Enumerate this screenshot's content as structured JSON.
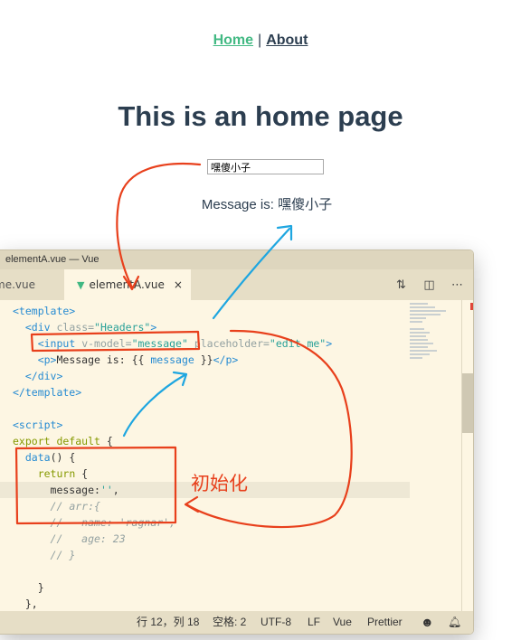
{
  "nav": {
    "home": "Home",
    "separator": "|",
    "about": "About"
  },
  "page": {
    "title": "This is an home page",
    "input_value": "嘿傻小子",
    "message_label": "Message is:",
    "message_value": "嘿傻小子"
  },
  "editor": {
    "window_title": "elementA.vue — Vue",
    "tabs": [
      {
        "label": "me.vue"
      },
      {
        "label": "elementA.vue",
        "close": "×"
      }
    ],
    "status": {
      "position": "行 12，列 18",
      "indent": "空格: 2",
      "encoding": "UTF-8",
      "eol": "LF",
      "language": "Vue",
      "formatter": "Prettier"
    }
  },
  "annotation": {
    "label": "初始化"
  },
  "colors": {
    "annotation_red": "#e8401c",
    "annotation_blue": "#1ea6e0",
    "vue_green": "#42b983"
  },
  "icons": [
    "git-compare-icon",
    "split-editor-icon",
    "more-icon",
    "feedback-smiley-icon",
    "bell-icon",
    "vue-file-icon",
    "close-icon"
  ]
}
